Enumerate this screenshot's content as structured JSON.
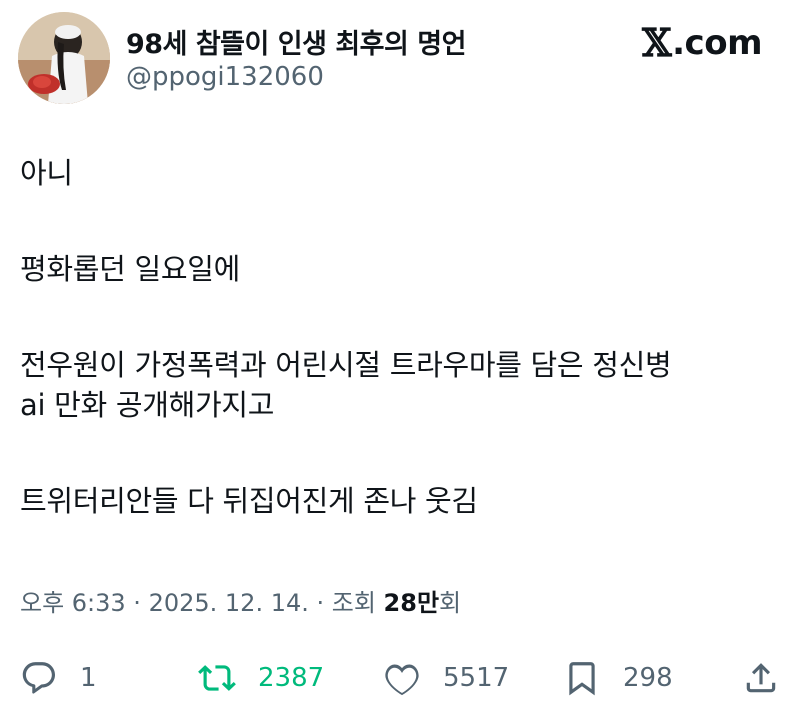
{
  "author": {
    "name": "98세 참뜰이 인생 최후의 명언",
    "handle": "@ppogi132060"
  },
  "brand": {
    "label": ".com",
    "icon": "x-logo-icon"
  },
  "tweet": {
    "lines": [
      "아니",
      "평화롭던 일요일에",
      "전우원이 가정폭력과 어린시절 트라우마를 담은 정신병",
      "ai 만화 공개해가지고",
      "트위터리안들 다 뒤집어진게 존나 웃김"
    ]
  },
  "meta": {
    "timestamp": "오후 6:33 · 2025. 12. 14. · 조회 ",
    "views": "28만",
    "views_suffix": "회"
  },
  "actions": {
    "reply_count": "1",
    "retweet_count": "2387",
    "like_count": "5517",
    "bookmark_count": "298"
  },
  "colors": {
    "text": "#0f1419",
    "secondary": "#536471",
    "retweet": "#00ba7c"
  }
}
